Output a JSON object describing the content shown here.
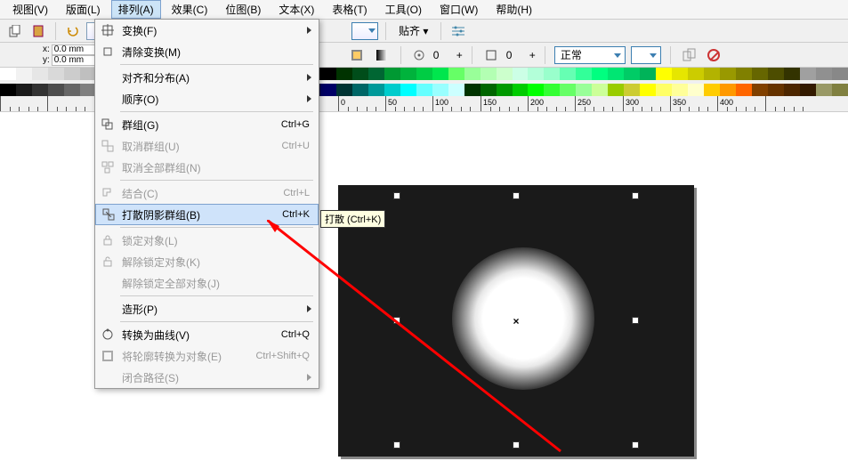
{
  "menubar": {
    "items": [
      "视图(V)",
      "版面(L)",
      "排列(A)",
      "效果(C)",
      "位图(B)",
      "文本(X)",
      "表格(T)",
      "工具(O)",
      "窗口(W)",
      "帮助(H)"
    ],
    "active_index": 2
  },
  "toolbar": {
    "snap_label": "贴齐 ▾"
  },
  "propbar": {
    "x_label": "x:",
    "y_label": "y:",
    "x_value": "0.0 mm",
    "y_value": "0.0 mm",
    "num_value": "0",
    "plus": "+",
    "mode_label": "正常"
  },
  "ruler": {
    "marks": [
      {
        "pos": 380,
        "label": "0"
      },
      {
        "pos": 433,
        "label": "50"
      },
      {
        "pos": 486,
        "label": "100"
      },
      {
        "pos": 540,
        "label": "150"
      },
      {
        "pos": 593,
        "label": "200"
      },
      {
        "pos": 646,
        "label": "250"
      },
      {
        "pos": 700,
        "label": "300"
      },
      {
        "pos": 753,
        "label": "350"
      },
      {
        "pos": 806,
        "label": "400"
      },
      {
        "pos": 860,
        "label": ""
      },
      {
        "pos": 0,
        "label": ""
      },
      {
        "pos": 53,
        "label": ""
      }
    ]
  },
  "dropdown": {
    "items": [
      {
        "label": "变换(F)",
        "sub": true,
        "enabled": true,
        "icon": "transform-icon"
      },
      {
        "label": "清除变换(M)",
        "sub": false,
        "enabled": true,
        "icon": "clear-transform-icon"
      },
      {
        "sep": true
      },
      {
        "label": "对齐和分布(A)",
        "sub": true,
        "enabled": true,
        "icon": ""
      },
      {
        "label": "顺序(O)",
        "sub": true,
        "enabled": true,
        "icon": ""
      },
      {
        "sep": true
      },
      {
        "label": "群组(G)",
        "sub": false,
        "enabled": true,
        "shortcut": "Ctrl+G",
        "icon": "group-icon"
      },
      {
        "label": "取消群组(U)",
        "sub": false,
        "enabled": false,
        "shortcut": "Ctrl+U",
        "icon": "ungroup-icon"
      },
      {
        "label": "取消全部群组(N)",
        "sub": false,
        "enabled": false,
        "icon": "ungroup-all-icon"
      },
      {
        "sep": true
      },
      {
        "label": "结合(C)",
        "sub": false,
        "enabled": false,
        "shortcut": "Ctrl+L",
        "icon": "combine-icon"
      },
      {
        "label": "打散阴影群组(B)",
        "sub": false,
        "enabled": true,
        "shortcut": "Ctrl+K",
        "highlight": true,
        "icon": "break-apart-icon"
      },
      {
        "sep": true
      },
      {
        "label": "锁定对象(L)",
        "sub": false,
        "enabled": false,
        "icon": "lock-icon"
      },
      {
        "label": "解除锁定对象(K)",
        "sub": false,
        "enabled": false,
        "icon": "unlock-icon"
      },
      {
        "label": "解除锁定全部对象(J)",
        "sub": false,
        "enabled": false,
        "icon": ""
      },
      {
        "sep": true
      },
      {
        "label": "造形(P)",
        "sub": true,
        "enabled": true,
        "icon": ""
      },
      {
        "sep": true
      },
      {
        "label": "转换为曲线(V)",
        "sub": false,
        "enabled": true,
        "shortcut": "Ctrl+Q",
        "icon": "to-curve-icon"
      },
      {
        "label": "将轮廓转换为对象(E)",
        "sub": false,
        "enabled": false,
        "shortcut": "Ctrl+Shift+Q",
        "icon": "outline-to-object-icon"
      },
      {
        "label": "闭合路径(S)",
        "sub": true,
        "enabled": false,
        "icon": ""
      }
    ]
  },
  "tooltip": "打散 (Ctrl+K)",
  "palette_top": [
    "#ffffff",
    "#f2f2f2",
    "#e6e6e6",
    "#d9d9d9",
    "#cccccc",
    "#bfbfbf",
    "#b3b3b3",
    "#a6a6a6",
    "#999999",
    "#8c8c8c",
    "#808080",
    "#737373",
    "#666666",
    "#595959",
    "#4d4d4d",
    "#404040",
    "#333333",
    "#262626",
    "#1a1a1a",
    "#0d0d0d",
    "#000000",
    "#003300",
    "#004d1a",
    "#006633",
    "#009933",
    "#00b33c",
    "#00cc44",
    "#00e64d",
    "#66ff66",
    "#99ff99",
    "#b3ffb3",
    "#ccffcc",
    "#ccffe6",
    "#b3ffd9",
    "#99ffcc",
    "#66ffb3",
    "#33ff99",
    "#00ff80",
    "#00e673",
    "#00cc66",
    "#00b359",
    "#ffff00",
    "#e6e600",
    "#cccc00",
    "#b3b300",
    "#999900",
    "#808000",
    "#666600",
    "#4d4d00",
    "#333300",
    "#a0a0a0",
    "#909090",
    "#888888"
  ],
  "palette_bot": [
    "#000000",
    "#1a1a1a",
    "#333333",
    "#4d4d4d",
    "#666666",
    "#808080",
    "#999999",
    "#b3b3b3",
    "#cccccc",
    "#e6e6e6",
    "#001a33",
    "#003366",
    "#004d99",
    "#0066cc",
    "#0080ff",
    "#3399ff",
    "#66b3ff",
    "#99ccff",
    "#cce6ff",
    "#000033",
    "#000066",
    "#003333",
    "#006666",
    "#009999",
    "#00cccc",
    "#00ffff",
    "#66ffff",
    "#99ffff",
    "#ccffff",
    "#003300",
    "#006600",
    "#009900",
    "#00cc00",
    "#00ff00",
    "#33ff33",
    "#66ff66",
    "#99ff99",
    "#ccff99",
    "#99cc00",
    "#cccc33",
    "#ffff00",
    "#ffff66",
    "#ffff99",
    "#ffffcc",
    "#ffcc00",
    "#ff9900",
    "#ff6600",
    "#804000",
    "#663300",
    "#4d2600",
    "#331a00",
    "#999966",
    "#808040"
  ]
}
